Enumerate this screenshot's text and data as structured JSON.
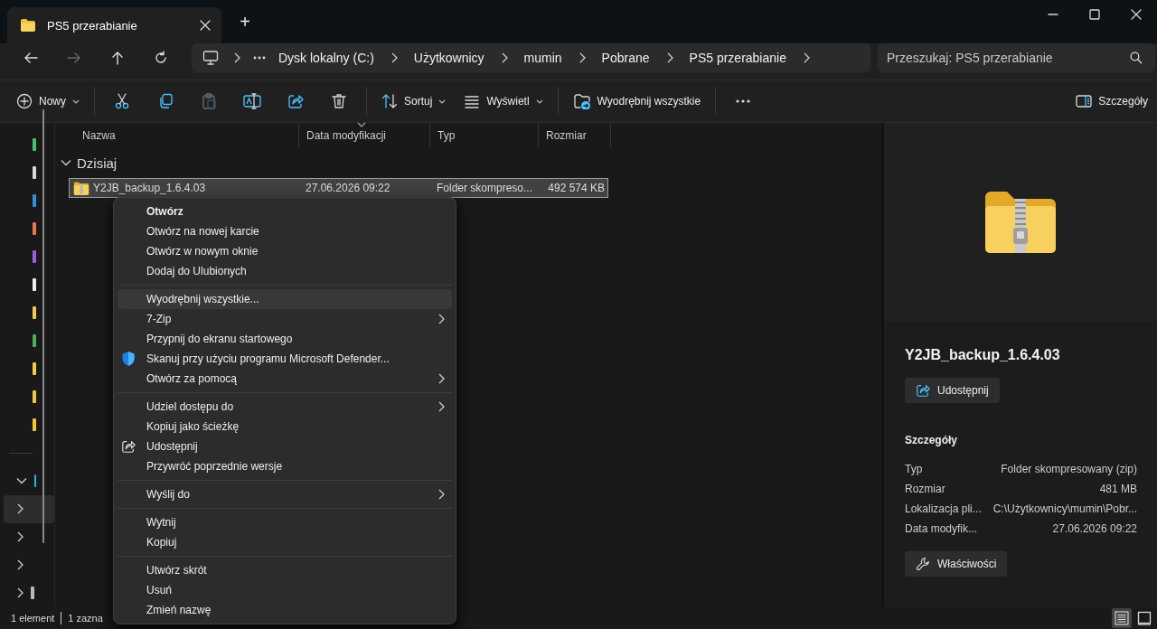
{
  "window": {
    "tab": {
      "title": "PS5 przerabianie",
      "selected": true
    },
    "new_tab": "+"
  },
  "address_bar": {
    "back_disabled": false,
    "forward_disabled": true,
    "breadcrumbs": [
      "Dysk lokalny (C:)",
      "Użytkownicy",
      "mumin",
      "Pobrane",
      "PS5 przerabianie"
    ],
    "search": {
      "placeholder": "Przeszukaj: PS5 przerabianie"
    }
  },
  "toolbar": {
    "items": [
      {
        "kind": "new",
        "label": "Nowy",
        "dropdown": true,
        "disabled": false
      },
      {
        "kind": "separator"
      },
      {
        "kind": "cut",
        "disabled": false
      },
      {
        "kind": "copy",
        "disabled": false
      },
      {
        "kind": "paste",
        "disabled": true
      },
      {
        "kind": "rename",
        "disabled": false
      },
      {
        "kind": "share",
        "disabled": false
      },
      {
        "kind": "delete",
        "disabled": false
      },
      {
        "kind": "separator"
      },
      {
        "kind": "sort",
        "label": "Sortuj",
        "dropdown": true,
        "disabled": false
      },
      {
        "kind": "view",
        "label": "Wyświetl",
        "dropdown": true,
        "disabled": false
      },
      {
        "kind": "separator"
      },
      {
        "kind": "extract",
        "label": "Wyodrębnij wszystkie",
        "dropdown": false,
        "disabled": false
      },
      {
        "kind": "separator"
      },
      {
        "kind": "more",
        "disabled": false
      },
      {
        "kind": "spacer"
      },
      {
        "kind": "details",
        "label": "Szczegóły",
        "dropdown": false,
        "disabled": false
      }
    ]
  },
  "sidebar": {
    "items": [
      {
        "kind": "pinned",
        "color": "#3ec46d"
      },
      {
        "kind": "pinned",
        "color": "#d9d9d9"
      },
      {
        "kind": "pinned",
        "color": "#2f8fe0"
      },
      {
        "kind": "pinned",
        "color": "#e8764f"
      },
      {
        "kind": "pinned",
        "color": "#9b5de5"
      },
      {
        "kind": "pinned",
        "color": "#eeeeee"
      },
      {
        "kind": "pinned",
        "color": "#f2c94c"
      },
      {
        "kind": "pinned",
        "color": "#4caf50"
      },
      {
        "kind": "pinned",
        "color": "#f7c948"
      },
      {
        "kind": "pinned",
        "color": "#f5c542"
      },
      {
        "kind": "pinned",
        "color": "#f4c430"
      },
      {
        "kind": "separator"
      },
      {
        "kind": "tree",
        "expanded": true,
        "selected": false,
        "color": "#2bb5d8"
      },
      {
        "kind": "tree",
        "expanded": false,
        "selected": true
      },
      {
        "kind": "tree",
        "expanded": false,
        "selected": false
      },
      {
        "kind": "tree",
        "expanded": false,
        "selected": false
      },
      {
        "kind": "tree",
        "expanded": false,
        "selected": false,
        "color": "#bbbbbb"
      }
    ]
  },
  "file_list": {
    "columns": [
      {
        "label": "Nazwa",
        "sorted": false
      },
      {
        "label": "Data modyfikacji",
        "sorted": true
      },
      {
        "label": "Typ",
        "sorted": false
      },
      {
        "label": "Rozmiar",
        "sorted": false
      }
    ],
    "groups": [
      {
        "label": "Dzisiaj",
        "expanded": true,
        "rows": [
          {
            "name": "Y2JB_backup_1.6.4.03",
            "modified": "27.06.2026 09:22",
            "type": "Folder skompreso...",
            "size": "492 574 KB",
            "selected": true
          }
        ]
      }
    ]
  },
  "context_menu": {
    "items": [
      {
        "kind": "item",
        "label": "Otwórz",
        "default": true,
        "submenu": false,
        "highlighted": false
      },
      {
        "kind": "item",
        "label": "Otwórz na nowej karcie",
        "default": false,
        "submenu": false,
        "highlighted": false
      },
      {
        "kind": "item",
        "label": "Otwórz w nowym oknie",
        "default": false,
        "submenu": false,
        "highlighted": false
      },
      {
        "kind": "item",
        "label": "Dodaj do Ulubionych",
        "default": false,
        "submenu": false,
        "highlighted": false
      },
      {
        "kind": "separator"
      },
      {
        "kind": "item",
        "label": "Wyodrębnij wszystkie...",
        "default": false,
        "submenu": false,
        "highlighted": true
      },
      {
        "kind": "item",
        "label": "7-Zip",
        "default": false,
        "submenu": true,
        "highlighted": false
      },
      {
        "kind": "item",
        "label": "Przypnij do ekranu startowego",
        "default": false,
        "submenu": false,
        "highlighted": false
      },
      {
        "kind": "shield",
        "label": "Skanuj przy użyciu programu Microsoft Defender...",
        "default": false,
        "submenu": false,
        "highlighted": false
      },
      {
        "kind": "item",
        "label": "Otwórz za pomocą",
        "default": false,
        "submenu": true,
        "highlighted": false
      },
      {
        "kind": "separator"
      },
      {
        "kind": "item",
        "label": "Udziel dostępu do",
        "default": false,
        "submenu": true,
        "highlighted": false
      },
      {
        "kind": "item",
        "label": "Kopiuj jako ścieżkę",
        "default": false,
        "submenu": false,
        "highlighted": false
      },
      {
        "kind": "share",
        "label": "Udostępnij",
        "default": false,
        "submenu": false,
        "highlighted": false
      },
      {
        "kind": "item",
        "label": "Przywróć poprzednie wersje",
        "default": false,
        "submenu": false,
        "highlighted": false
      },
      {
        "kind": "separator"
      },
      {
        "kind": "item",
        "label": "Wyślij do",
        "default": false,
        "submenu": true,
        "highlighted": false
      },
      {
        "kind": "separator"
      },
      {
        "kind": "item",
        "label": "Wytnij",
        "default": false,
        "submenu": false,
        "highlighted": false
      },
      {
        "kind": "item",
        "label": "Kopiuj",
        "default": false,
        "submenu": false,
        "highlighted": false
      },
      {
        "kind": "separator"
      },
      {
        "kind": "item",
        "label": "Utwórz skrót",
        "default": false,
        "submenu": false,
        "highlighted": false
      },
      {
        "kind": "item",
        "label": "Usuń",
        "default": false,
        "submenu": false,
        "highlighted": false
      },
      {
        "kind": "item",
        "label": "Zmień nazwę",
        "default": false,
        "submenu": false,
        "highlighted": false
      }
    ]
  },
  "details_pane": {
    "title": "Y2JB_backup_1.6.4.03",
    "share_button": "Udostępnij",
    "section": "Szczegóły",
    "properties": [
      {
        "label": "Typ",
        "value": "Folder skompresowany (zip)"
      },
      {
        "label": "Rozmiar",
        "value": "481 MB"
      },
      {
        "label": "Lokalizacja pli...",
        "value": "C:\\Użytkownicy\\mumin\\Pobr..."
      },
      {
        "label": "Data modyfik...",
        "value": "27.06.2026 09:22"
      }
    ],
    "properties_button": "Właściwości"
  },
  "status_bar": {
    "items": [
      "1 element",
      "1 zazna"
    ],
    "views": [
      {
        "selected": true
      },
      {
        "selected": false
      }
    ]
  }
}
